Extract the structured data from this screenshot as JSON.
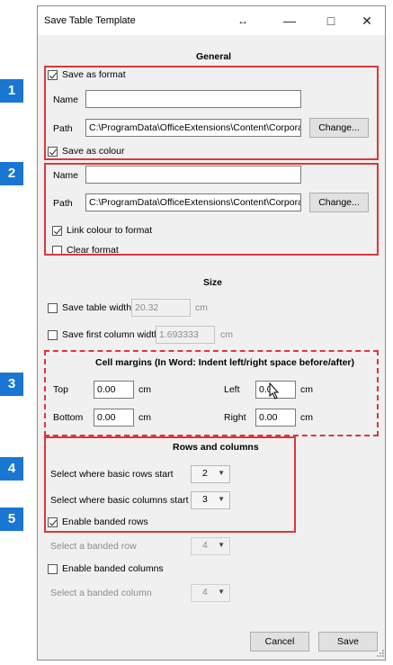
{
  "window": {
    "title": "Save Table Template",
    "resize_glyph": "↔",
    "minimize": "—",
    "maximize": "□",
    "close": "✕"
  },
  "badges": [
    "1",
    "2",
    "3",
    "4",
    "5"
  ],
  "general": {
    "title": "General",
    "save_as_format": "Save as format",
    "name_label": "Name",
    "name_value": "",
    "path_label": "Path",
    "path_value": "C:\\ProgramData\\OfficeExtensions\\Content\\CorporateT",
    "change_label": "Change...",
    "save_as_colour": "Save as colour",
    "colour_name_label": "Name",
    "colour_name_value": "",
    "colour_path_label": "Path",
    "colour_path_value": "C:\\ProgramData\\OfficeExtensions\\Content\\CorporateT",
    "colour_change_label": "Change...",
    "link_colour": "Link colour to format",
    "clear_format": "Clear format"
  },
  "size": {
    "title": "Size",
    "table_width_label": "Save table width",
    "table_width_value": "20.32",
    "table_width_unit": "cm",
    "first_col_label": "Save first column width",
    "first_col_value": "1.693333",
    "first_col_unit": "cm"
  },
  "margins": {
    "title": "Cell margins (In Word: Indent left/right space before/after)",
    "top_label": "Top",
    "top_value": "0.00",
    "top_unit": "cm",
    "left_label": "Left",
    "left_value": "0.0",
    "left_unit": "cm",
    "bottom_label": "Bottom",
    "bottom_value": "0.00",
    "bottom_unit": "cm",
    "right_label": "Right",
    "right_value": "0.00",
    "right_unit": "cm"
  },
  "rows": {
    "title": "Rows and columns",
    "rows_start_label": "Select where basic rows start",
    "rows_start_value": "2",
    "cols_start_label": "Select where basic columns start",
    "cols_start_value": "3",
    "banded_rows": "Enable banded rows",
    "banded_row_label": "Select a banded row",
    "banded_row_value": "4",
    "banded_cols": "Enable banded columns",
    "banded_col_label": "Select a banded column",
    "banded_col_value": "4"
  },
  "footer": {
    "cancel": "Cancel",
    "save": "Save"
  },
  "colors": {
    "accent_badge": "#1976d2",
    "highlight_box": "#d9393a"
  }
}
